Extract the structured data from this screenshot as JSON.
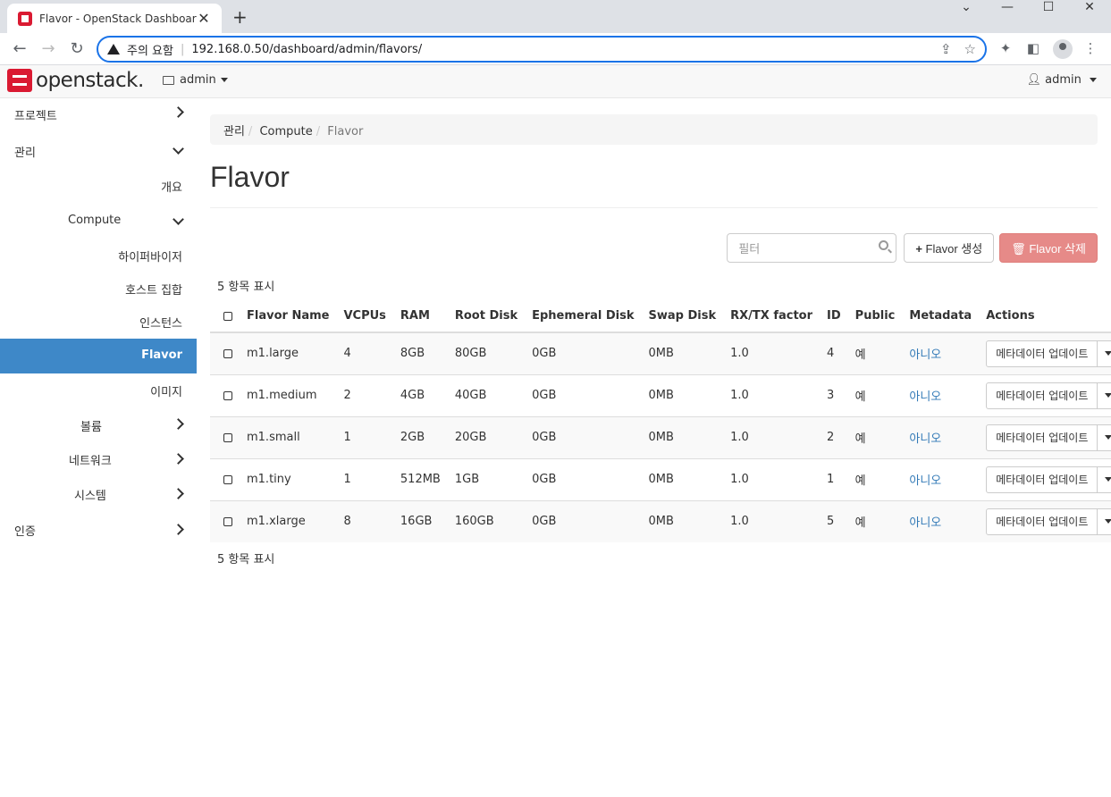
{
  "browser": {
    "tab_title": "Flavor - OpenStack Dashboard",
    "security_label": "주의 요함",
    "url": "192.168.0.50/dashboard/admin/flavors/"
  },
  "navbar": {
    "logo_text": "openstack.",
    "project": "admin",
    "user": "admin"
  },
  "sidebar": {
    "project": "프로젝트",
    "admin": "관리",
    "overview": "개요",
    "compute": "Compute",
    "hypervisors": "하이퍼바이저",
    "host_aggregates": "호스트 집합",
    "instances": "인스턴스",
    "flavors": "Flavor",
    "images": "이미지",
    "volume": "볼륨",
    "network": "네트워크",
    "system": "시스템",
    "identity": "인증"
  },
  "breadcrumb": [
    "관리",
    "Compute",
    "Flavor"
  ],
  "page_title": "Flavor",
  "toolbar": {
    "filter_placeholder": "필터",
    "create_label": "Flavor 생성",
    "delete_label": "Flavor 삭제"
  },
  "table": {
    "count_label": "5 항목 표시",
    "headers": [
      "Flavor Name",
      "VCPUs",
      "RAM",
      "Root Disk",
      "Ephemeral Disk",
      "Swap Disk",
      "RX/TX factor",
      "ID",
      "Public",
      "Metadata",
      "Actions"
    ],
    "action_label": "메타데이터 업데이트",
    "rows": [
      {
        "name": "m1.large",
        "vcpus": "4",
        "ram": "8GB",
        "root": "80GB",
        "eph": "0GB",
        "swap": "0MB",
        "rxtx": "1.0",
        "id": "4",
        "public": "예",
        "metadata": "아니오"
      },
      {
        "name": "m1.medium",
        "vcpus": "2",
        "ram": "4GB",
        "root": "40GB",
        "eph": "0GB",
        "swap": "0MB",
        "rxtx": "1.0",
        "id": "3",
        "public": "예",
        "metadata": "아니오"
      },
      {
        "name": "m1.small",
        "vcpus": "1",
        "ram": "2GB",
        "root": "20GB",
        "eph": "0GB",
        "swap": "0MB",
        "rxtx": "1.0",
        "id": "2",
        "public": "예",
        "metadata": "아니오"
      },
      {
        "name": "m1.tiny",
        "vcpus": "1",
        "ram": "512MB",
        "root": "1GB",
        "eph": "0GB",
        "swap": "0MB",
        "rxtx": "1.0",
        "id": "1",
        "public": "예",
        "metadata": "아니오"
      },
      {
        "name": "m1.xlarge",
        "vcpus": "8",
        "ram": "16GB",
        "root": "160GB",
        "eph": "0GB",
        "swap": "0MB",
        "rxtx": "1.0",
        "id": "5",
        "public": "예",
        "metadata": "아니오"
      }
    ]
  }
}
